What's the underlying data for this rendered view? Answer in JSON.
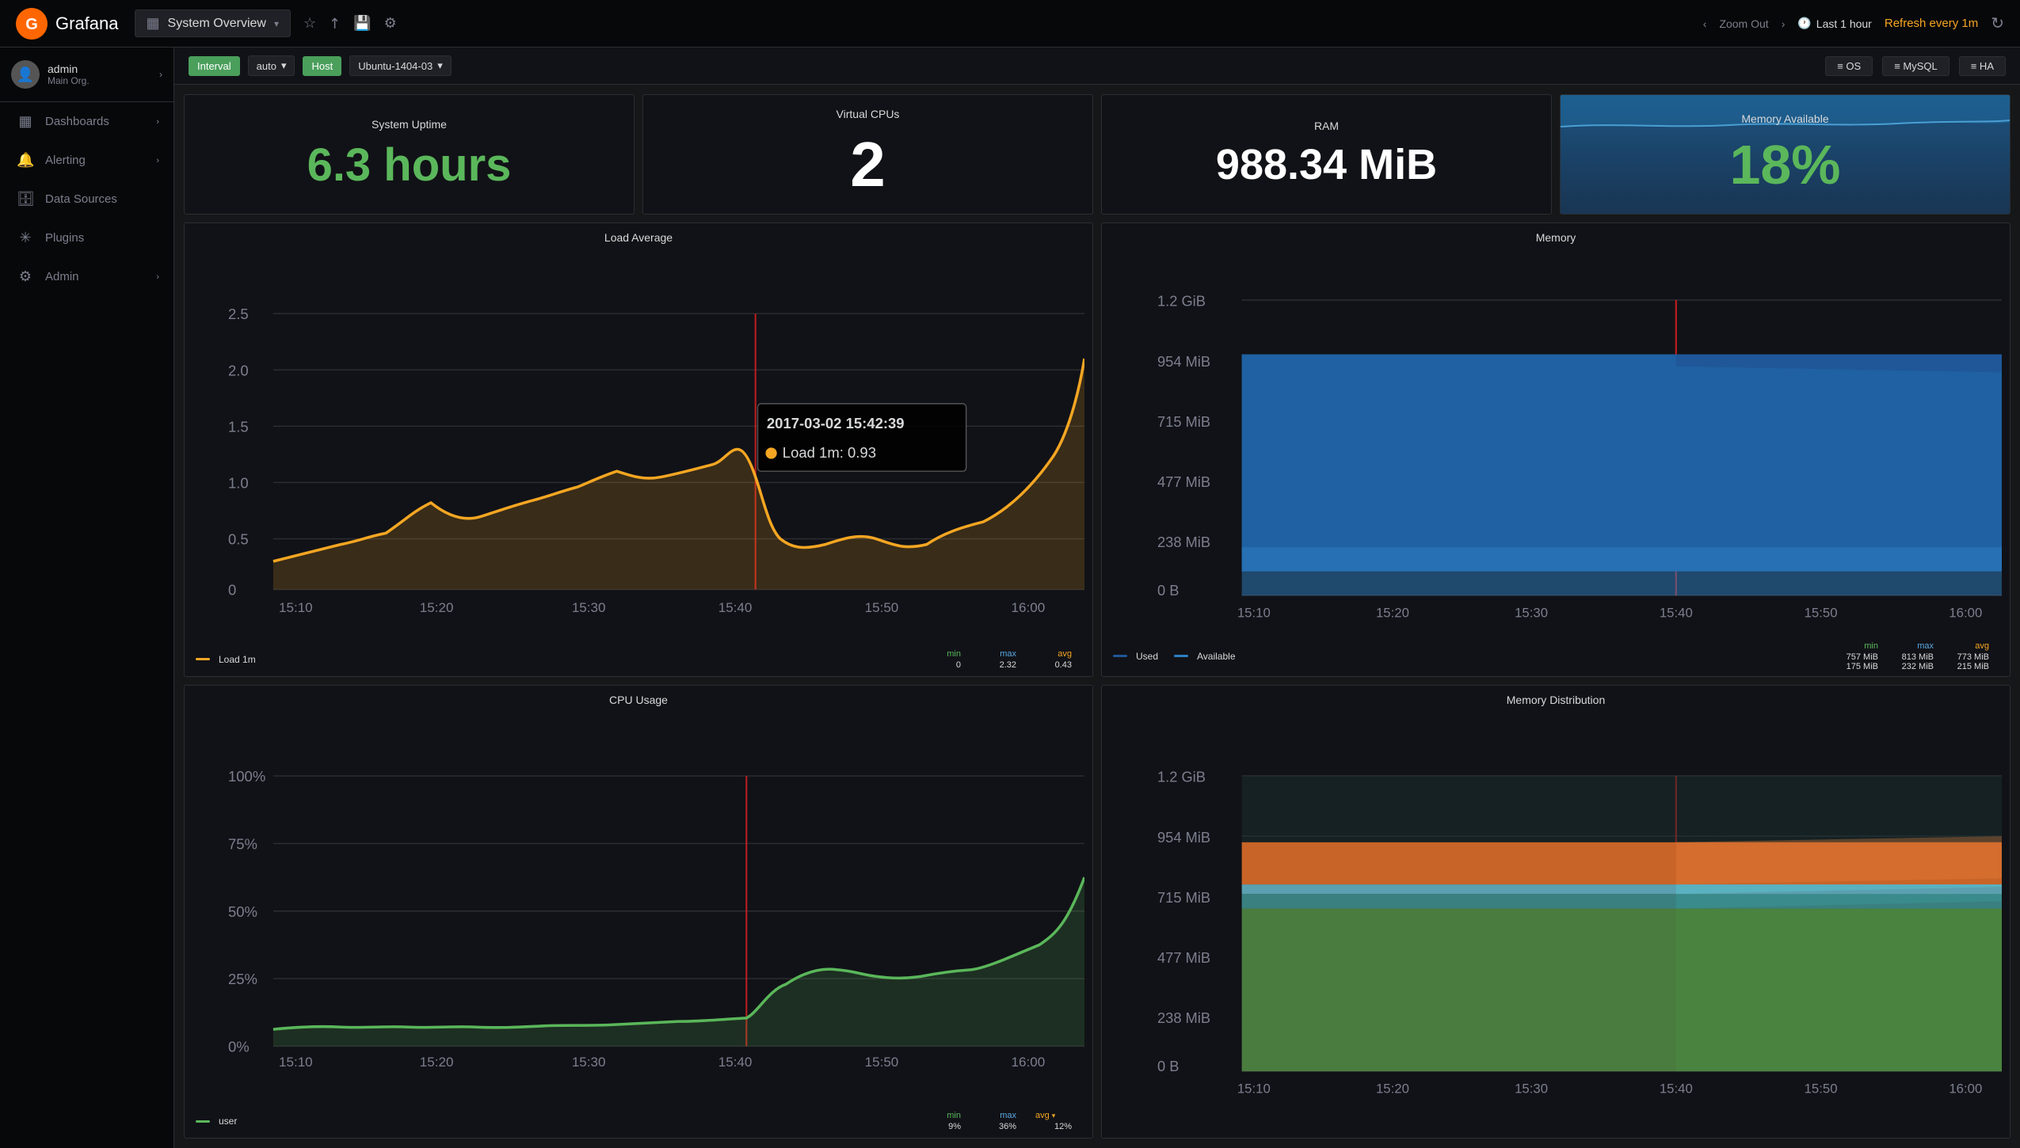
{
  "topbar": {
    "logo_text": "Grafana",
    "dashboard_title": "System Overview",
    "icon_star": "☆",
    "icon_share": "⬆",
    "icon_save": "💾",
    "icon_settings": "⚙",
    "zoom_out": "Zoom Out",
    "time_range": "Last 1 hour",
    "refresh_label": "Refresh every 1m",
    "refresh_icon": "↻"
  },
  "sidebar": {
    "user_name": "admin",
    "user_org": "Main Org.",
    "nav_items": [
      {
        "label": "Dashboards",
        "icon": "▦",
        "has_arrow": true
      },
      {
        "label": "Alerting",
        "icon": "🔔",
        "has_arrow": true
      },
      {
        "label": "Data Sources",
        "icon": "🗄",
        "has_arrow": false
      },
      {
        "label": "Plugins",
        "icon": "⚙",
        "has_arrow": false
      },
      {
        "label": "Admin",
        "icon": "⚙",
        "has_arrow": true
      }
    ]
  },
  "toolbar": {
    "interval_label": "Interval",
    "interval_value": "auto",
    "host_label": "Host",
    "host_value": "Ubuntu-1404-03",
    "menu_os": "≡ OS",
    "menu_mysql": "≡ MySQL",
    "menu_ha": "≡ HA"
  },
  "stats": {
    "uptime_title": "System Uptime",
    "uptime_value": "6.3 hours",
    "vcpu_title": "Virtual CPUs",
    "vcpu_value": "2",
    "ram_title": "RAM",
    "ram_value": "988.34 MiB",
    "mem_avail_title": "Memory Available",
    "mem_avail_value": "18%"
  },
  "load_avg": {
    "title": "Load Average",
    "y_labels": [
      "2.5",
      "2.0",
      "1.5",
      "1.0",
      "0.5",
      "0"
    ],
    "x_labels": [
      "15:10",
      "15:20",
      "15:30",
      "15:40",
      "15:50",
      "16:00"
    ],
    "legend_label": "Load 1m",
    "min_val": "0",
    "max_val": "2.32",
    "avg_val": "0.43",
    "tooltip_time": "2017-03-02 15:42:39",
    "tooltip_label": "Load 1m:",
    "tooltip_value": "0.93"
  },
  "memory": {
    "title": "Memory",
    "y_labels": [
      "1.2 GiB",
      "954 MiB",
      "715 MiB",
      "477 MiB",
      "238 MiB",
      "0 B"
    ],
    "x_labels": [
      "15:10",
      "15:20",
      "15:30",
      "15:40",
      "15:50",
      "16:00"
    ],
    "legend_used": "Used",
    "legend_avail": "Available",
    "used_min": "757 MiB",
    "used_max": "813 MiB",
    "used_avg": "773 MiB",
    "avail_min": "175 MiB",
    "avail_max": "232 MiB",
    "avail_avg": "215 MiB"
  },
  "cpu_usage": {
    "title": "CPU Usage",
    "y_labels": [
      "100%",
      "75%",
      "50%",
      "25%",
      "0%"
    ],
    "x_labels": [
      "15:10",
      "15:20",
      "15:30",
      "15:40",
      "15:50",
      "16:00"
    ],
    "legend_label": "user",
    "min_val": "9%",
    "max_val": "36%",
    "avg_val": "12%"
  },
  "mem_dist": {
    "title": "Memory Distribution",
    "y_labels": [
      "1.2 GiB",
      "954 MiB",
      "715 MiB",
      "477 MiB",
      "238 MiB",
      "0 B"
    ],
    "x_labels": [
      "15:10",
      "15:20",
      "15:30",
      "15:40",
      "15:50",
      "16:00"
    ]
  }
}
